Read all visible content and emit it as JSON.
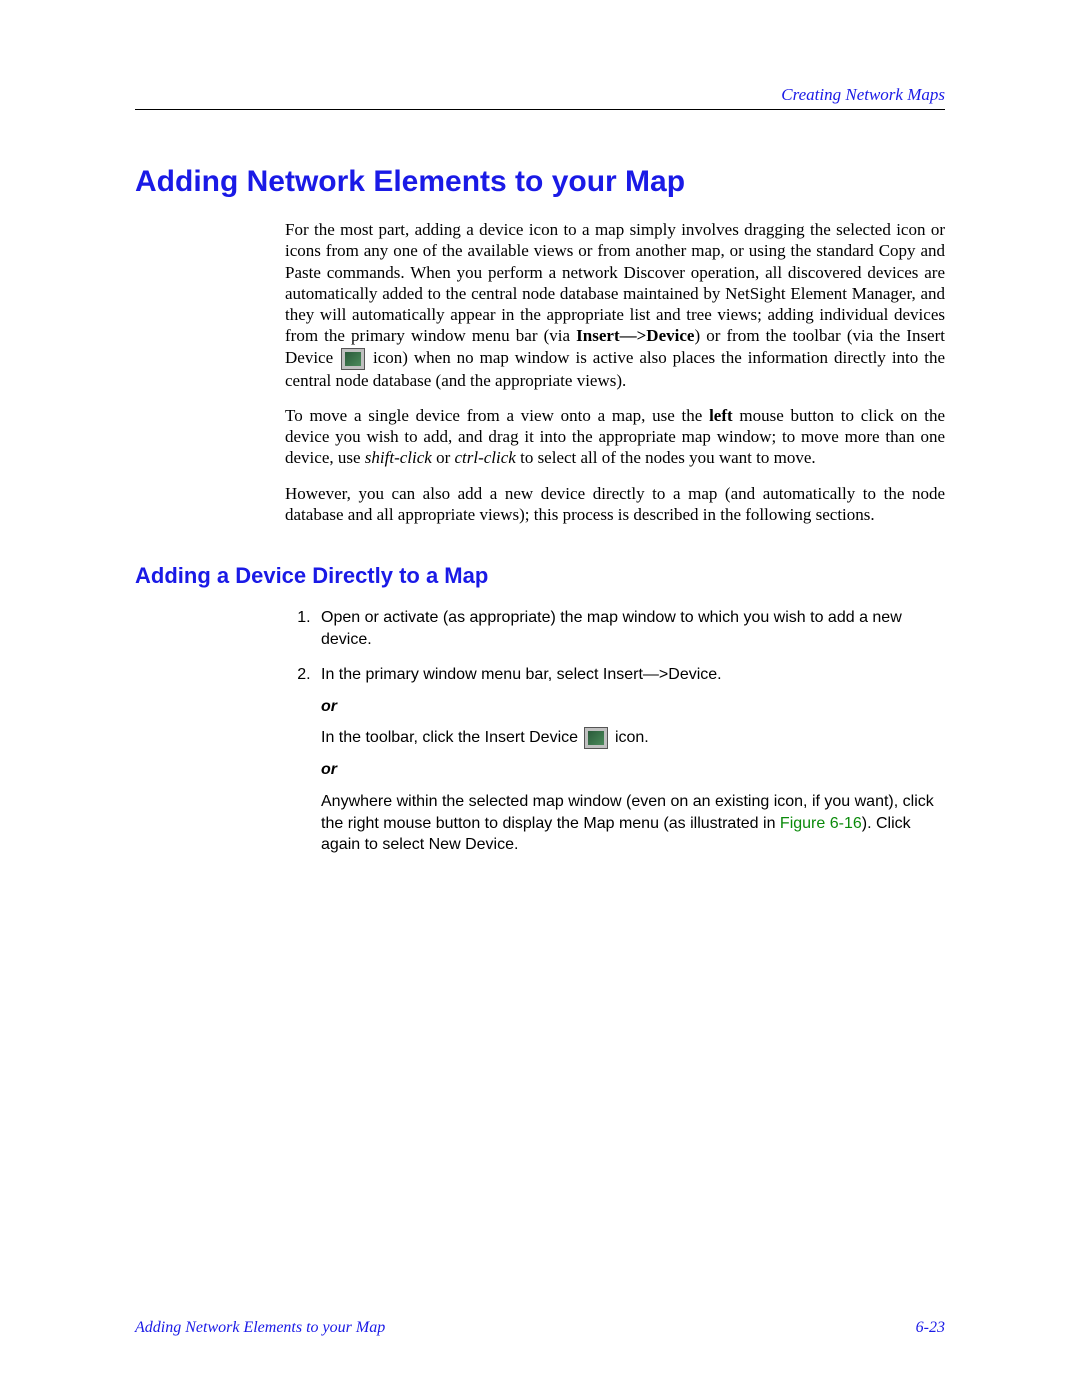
{
  "header": {
    "running_title": "Creating Network Maps"
  },
  "title": "Adding Network Elements to your Map",
  "para1": {
    "t1": "For the most part, adding a device icon to a map simply involves dragging the selected icon or icons from any one of the available views or from another map, or using the standard Copy and Paste commands. When you perform a network Discover operation, all discovered devices are automatically added to the central node database maintained by NetSight Element Manager, and they will automatically appear in the appropriate list and tree views; adding individual devices from the primary window menu bar (via ",
    "bold1": "Insert—>Device",
    "t2": ") or from the toolbar (via the Insert Device ",
    "t3": " icon) when no map window is active also places the information directly into the central node database (and the appropriate views)."
  },
  "para2": {
    "t1": "To move a single device from a view onto a map, use the ",
    "bold1": "left",
    "t2": " mouse button to click on the device you wish to add, and drag it into the appropriate map window; to move more than one device, use ",
    "ital1": "shift-click",
    "t3": " or ",
    "ital2": "ctrl-click",
    "t4": " to select all of the nodes you want to move."
  },
  "para3": "However, you can also add a new device directly to a map (and automatically to the node database and all appropriate views); this process is described in the following sections.",
  "subheading": "Adding a Device Directly to a Map",
  "steps": {
    "s1": "Open or activate (as appropriate) the map window to which you wish to add a new device.",
    "s2": {
      "t1": "In the primary window menu bar, select ",
      "bold1": "Insert—>Device",
      "t2": ".",
      "or": "or",
      "alt1a": "In the toolbar, click the ",
      "alt1b": "Insert Device",
      "alt1c": " icon.",
      "alt2a": "Anywhere within the selected map window (even on an existing icon, if you want), click the ",
      "alt2b": "right",
      "alt2c": " mouse button to display the Map menu (as illustrated in ",
      "figref": "Figure 6-16",
      "alt2d": "). Click again to select ",
      "alt2e": "New Device",
      "alt2f": "."
    }
  },
  "footer": {
    "left": "Adding Network Elements to your Map",
    "right": "6-23"
  }
}
